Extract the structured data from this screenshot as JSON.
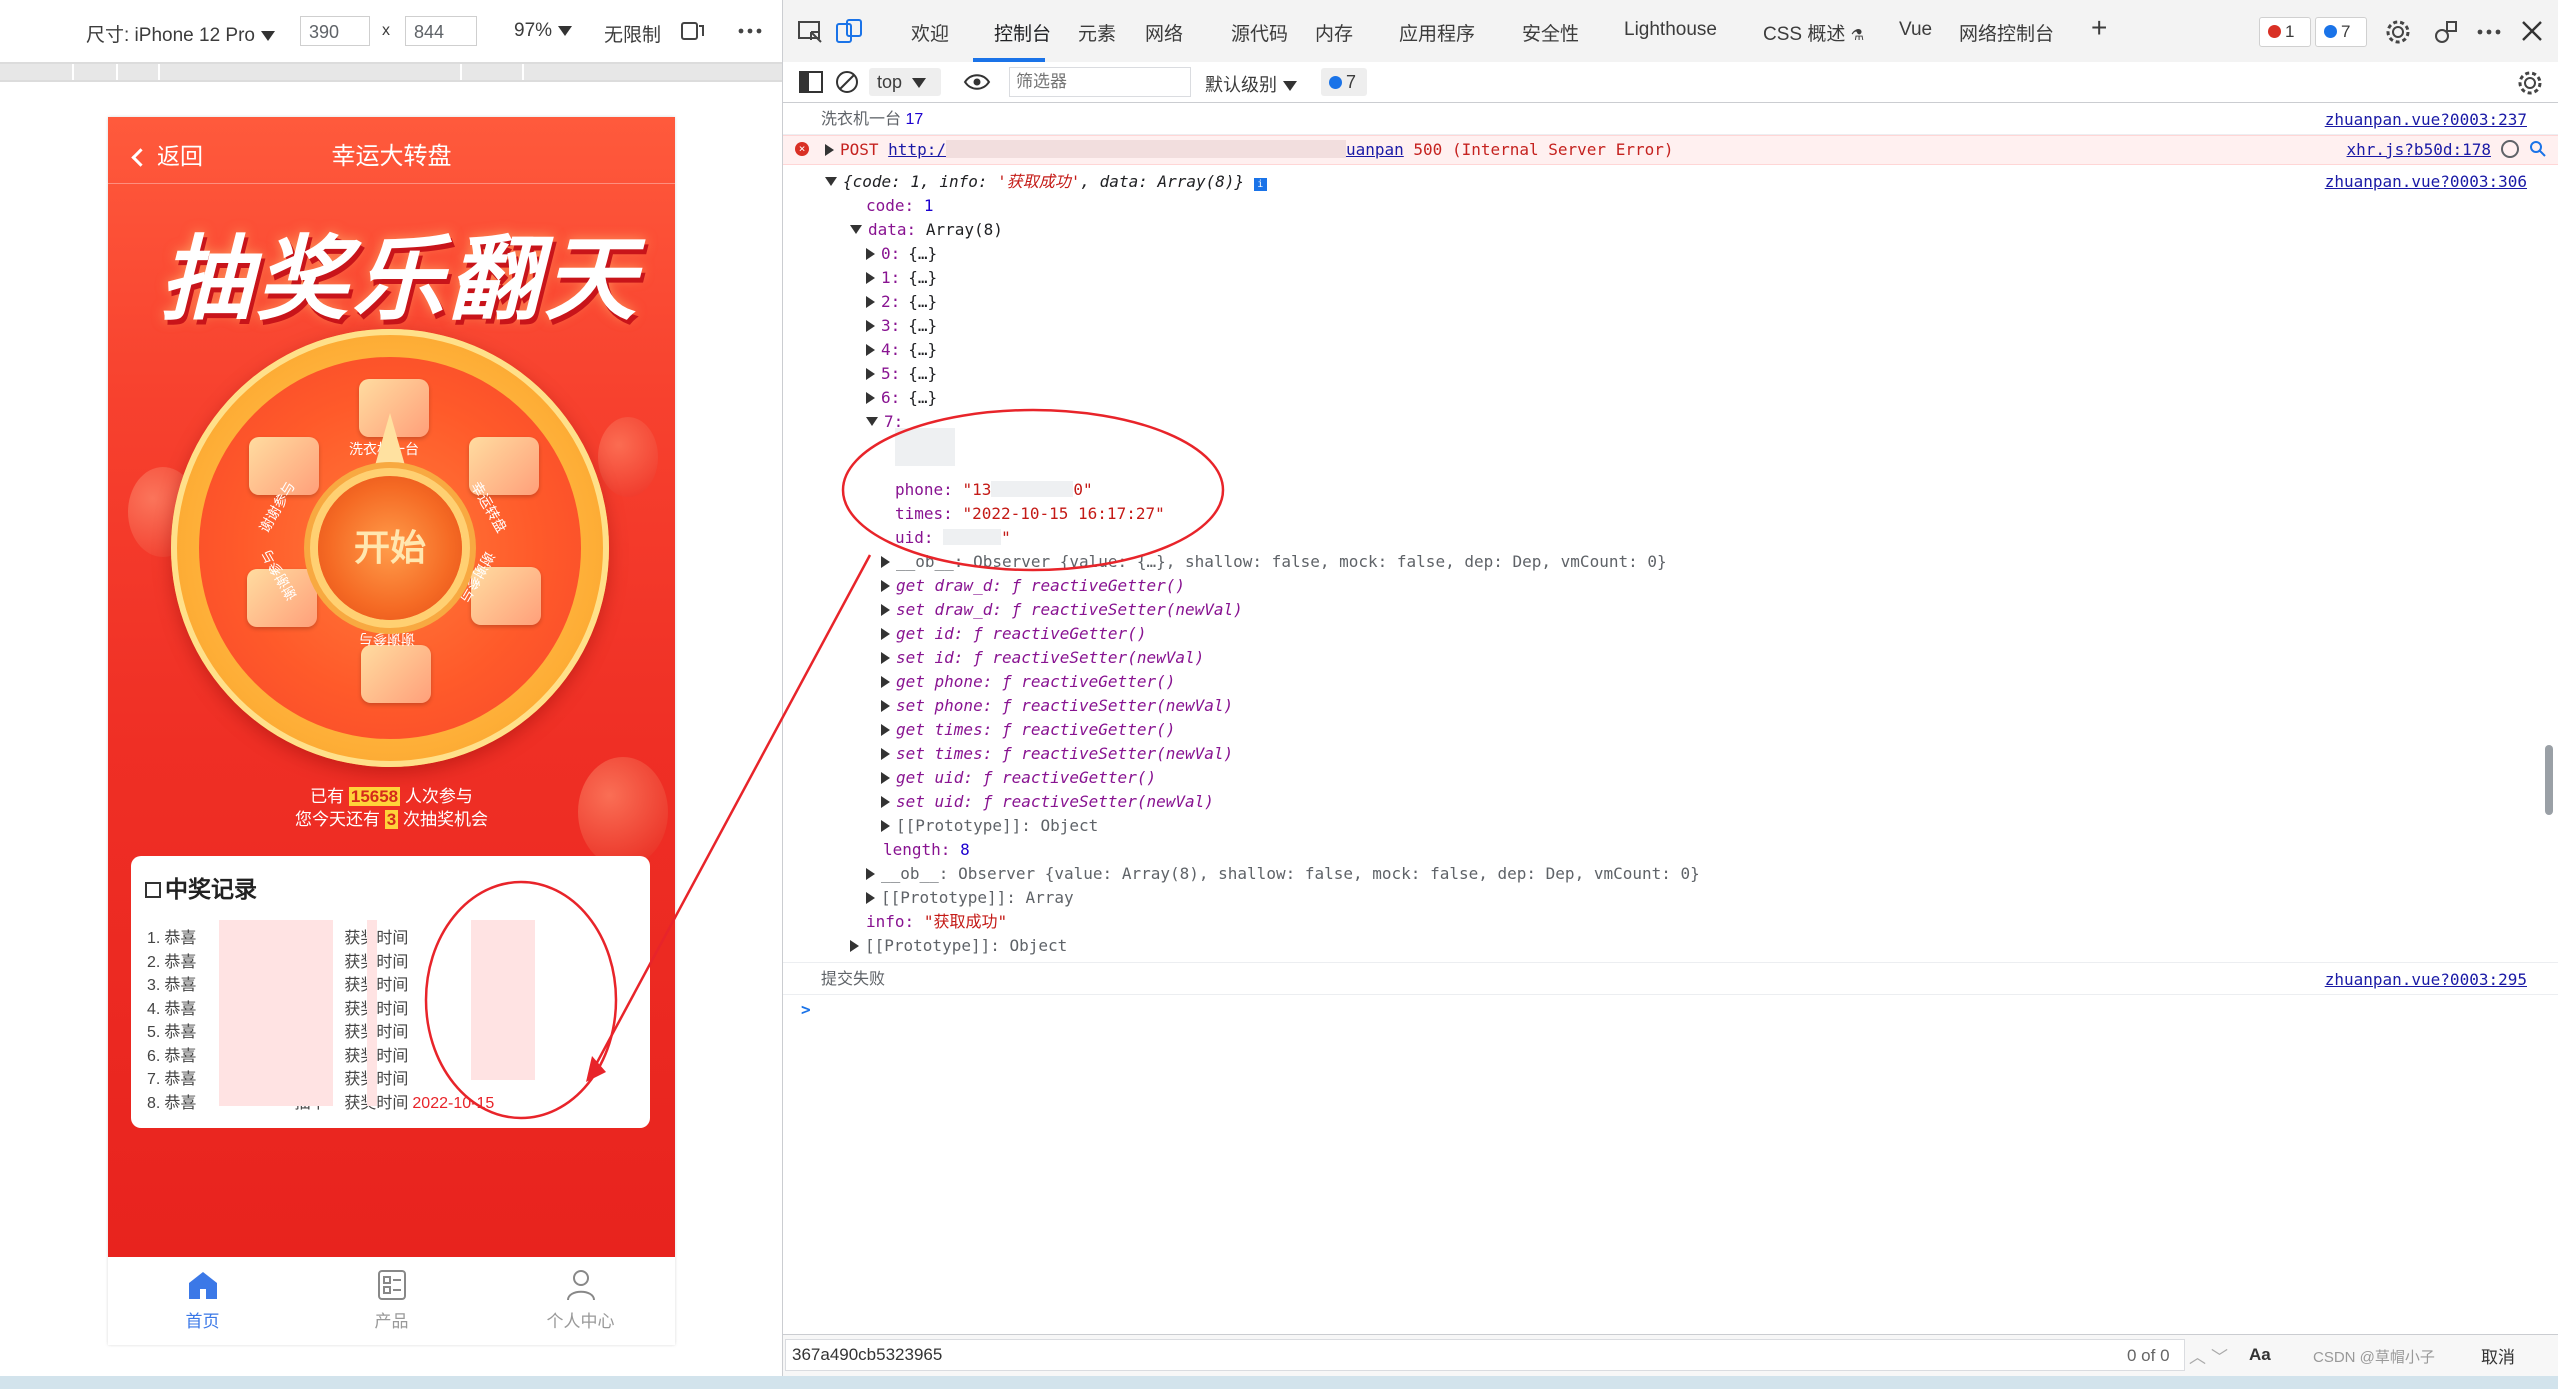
{
  "device_toolbar": {
    "dimensions_label": "尺寸: iPhone 12 Pro",
    "width": "390",
    "height": "844",
    "times": "x",
    "zoom": "97%",
    "throttle": "无限制"
  },
  "app": {
    "back_label": "返回",
    "title": "幸运大转盘",
    "banner": "抽奖乐翻天",
    "start_label": "开始",
    "prizes": [
      "洗衣机一台",
      "幸运转盘",
      "谢谢参与",
      "谢谢参与",
      "谢谢参与",
      "谢谢参与"
    ],
    "stats": {
      "line1_pre": "已有",
      "participants": "15658",
      "line1_post": "人次参与",
      "line2_pre": "您今天还有",
      "chances": "3",
      "line2_post": "次抽奖机会"
    },
    "records_title": "中奖记录",
    "records": [
      {
        "num": "1.",
        "pre": "恭喜",
        "mid": "抽中",
        "time_label": "获奖时间",
        "time": ""
      },
      {
        "num": "2.",
        "pre": "恭喜",
        "mid": "抽中",
        "time_label": "获奖时间",
        "time": ""
      },
      {
        "num": "3.",
        "pre": "恭喜",
        "mid": "抽中",
        "time_label": "获奖时间",
        "time": ""
      },
      {
        "num": "4.",
        "pre": "恭喜",
        "mid": "抽中",
        "time_label": "获奖时间",
        "time": ""
      },
      {
        "num": "5.",
        "pre": "恭喜",
        "mid": "抽中",
        "time_label": "获奖时间",
        "time": ""
      },
      {
        "num": "6.",
        "pre": "恭喜",
        "mid": "抽中",
        "time_label": "获奖时间",
        "time": ""
      },
      {
        "num": "7.",
        "pre": "恭喜",
        "mid": "抽中",
        "time_label": "获奖时间",
        "time": ""
      },
      {
        "num": "8.",
        "pre": "恭喜",
        "mid": "抽中",
        "time_label": "获奖时间",
        "time": "2022-10-15"
      }
    ],
    "tabs": [
      {
        "label": "首页",
        "active": true
      },
      {
        "label": "产品",
        "active": false
      },
      {
        "label": "个人中心",
        "active": false
      }
    ]
  },
  "devtools": {
    "tabs": [
      "欢迎",
      "控制台",
      "元素",
      "网络",
      "源代码",
      "内存",
      "应用程序",
      "安全性",
      "Lighthouse",
      "CSS 概述",
      "Vue",
      "网络控制台"
    ],
    "active_tab": "控制台",
    "error_count": "1",
    "message_count": "7",
    "context": "top",
    "filter_placeholder": "筛选器",
    "level": "默认级别",
    "issues_count": "7",
    "console": {
      "log1_text": "洗衣机一台",
      "log1_num": "17",
      "log1_src": "zhuanpan.vue?0003:237",
      "err_method": "POST",
      "err_url_start": "http:/",
      "err_url_end": "uanpan",
      "err_status": "500 (Internal Server Error)",
      "err_src": "xhr.js?b50d:178",
      "obj_summary_pre": "{code: 1, info: ",
      "obj_summary_info": "'获取成功'",
      "obj_summary_post": ", data: Array(8)}",
      "obj_src": "zhuanpan.vue?0003:306",
      "code_key": "code:",
      "code_val": "1",
      "data_key": "data:",
      "data_val": "Array(8)",
      "items": [
        "0:",
        "1:",
        "2:",
        "3:",
        "4:",
        "5:",
        "6:"
      ],
      "item_collapsed": "{…}",
      "item7_key": "7:",
      "phone_key": "phone:",
      "phone_val_start": "\"13",
      "phone_val_end": "0\"",
      "times_key": "times:",
      "times_val": "\"2022-10-15 16:17:27\"",
      "uid_key": "uid:",
      "uid_val_end": "\"",
      "ob_line": "__ob__: Observer {value: {…}, shallow: false, mock: false, dep: Dep, vmCount: 0}",
      "getset": [
        "get draw_d: ƒ reactiveGetter()",
        "set draw_d: ƒ reactiveSetter(newVal)",
        "get id: ƒ reactiveGetter()",
        "set id: ƒ reactiveSetter(newVal)",
        "get phone: ƒ reactiveGetter()",
        "set phone: ƒ reactiveSetter(newVal)",
        "get times: ƒ reactiveGetter()",
        "set times: ƒ reactiveSetter(newVal)",
        "get uid: ƒ reactiveGetter()",
        "set uid: ƒ reactiveSetter(newVal)"
      ],
      "proto_obj": "[[Prototype]]: Object",
      "length_key": "length:",
      "length_val": "8",
      "ob_arr": "__ob__: Observer {value: Array(8), shallow: false, mock: false, dep: Dep, vmCount: 0}",
      "proto_arr": "[[Prototype]]: Array",
      "info_key": "info:",
      "info_val": "\"获取成功\"",
      "proto_root": "[[Prototype]]: Object",
      "log2_text": "提交失败",
      "log2_src": "zhuanpan.vue?0003:295",
      "prompt": ">"
    },
    "search_value": "367a490cb5323965",
    "search_result": "0 of 0",
    "case_label": "Aa",
    "cancel_label": "取消",
    "watermark": "CSDN @草帽小子"
  },
  "colors": {
    "app_red": "#ef2f25",
    "accent_blue": "#1a73e8",
    "annotation_red": "#e8242a",
    "error_bg": "#fff0f0"
  }
}
